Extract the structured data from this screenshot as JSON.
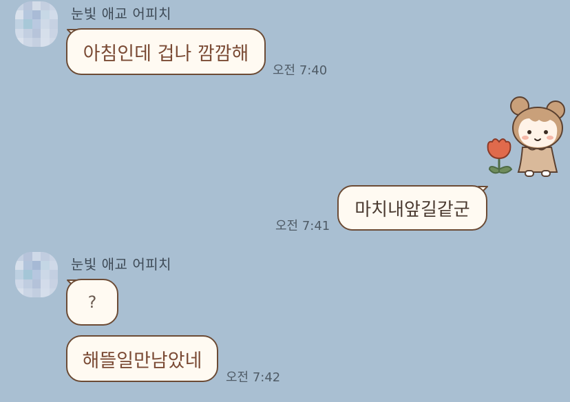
{
  "messages": [
    {
      "sender": "눈빛 애교 어피치",
      "text": "아침인데 겁나 깜깜해",
      "time": "오전 7:40"
    },
    {
      "sticker": "girl-with-tulip-sticker"
    },
    {
      "text": "마치내앞길같군",
      "time": "오전 7:41"
    },
    {
      "sender": "눈빛 애교 어피치",
      "text": "?"
    },
    {
      "text": "해뜰일만남았네",
      "time": "오전 7:42"
    }
  ],
  "colors": {
    "background": "#a9bfd2",
    "bubble_fill": "#fffaf2",
    "bubble_border": "#6b4a34",
    "text_brown": "#7a4a34"
  }
}
